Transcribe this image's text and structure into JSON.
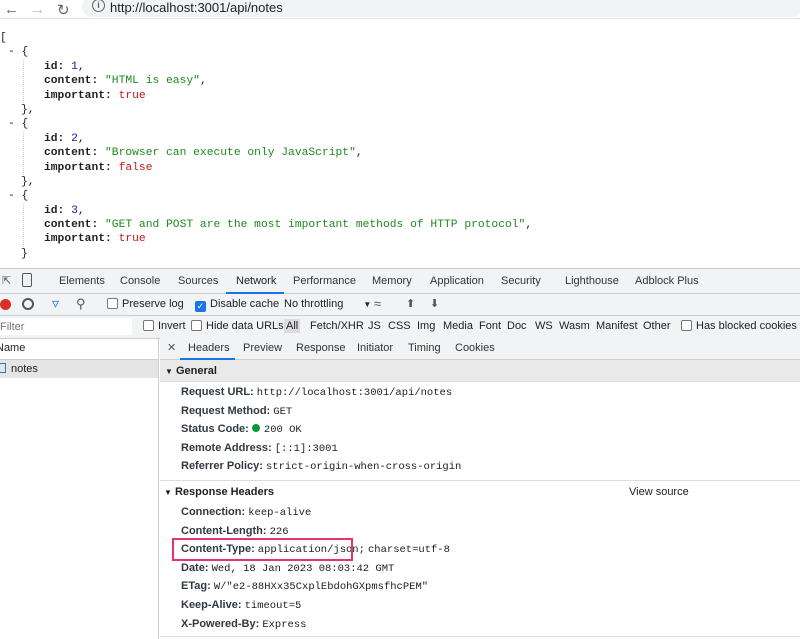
{
  "browser": {
    "url": "http://localhost:3001/api/notes"
  },
  "notes": [
    {
      "id": "1",
      "content": "\"HTML is easy\"",
      "important": "true"
    },
    {
      "id": "2",
      "content": "\"Browser can execute only JavaScript\"",
      "important": "false"
    },
    {
      "id": "3",
      "content": "\"GET and POST are the most important methods of HTTP protocol\"",
      "important": "true"
    }
  ],
  "json_labels": {
    "open_bracket": "[",
    "collapse": "- {",
    "close_obj_comma": "},",
    "close_obj": "}",
    "id_key": "id:",
    "content_key": "content:",
    "important_key": "important:"
  },
  "devtools": {
    "tabs": [
      "Elements",
      "Console",
      "Sources",
      "Network",
      "Performance",
      "Memory",
      "Application",
      "Security",
      "Lighthouse",
      "Adblock Plus"
    ],
    "active_tab": "Network",
    "toolbar": {
      "preserve_log": "Preserve log",
      "disable_cache": "Disable cache",
      "throttling": "No throttling"
    },
    "filter": {
      "placeholder": "Filter",
      "invert": "Invert",
      "hide_data_urls": "Hide data URLs",
      "types": [
        "All",
        "Fetch/XHR",
        "JS",
        "CSS",
        "Img",
        "Media",
        "Font",
        "Doc",
        "WS",
        "Wasm",
        "Manifest",
        "Other"
      ],
      "has_blocked_cookies": "Has blocked cookies"
    },
    "request_list": {
      "header": "Name",
      "items": [
        "notes"
      ]
    },
    "detail_tabs": [
      "Headers",
      "Preview",
      "Response",
      "Initiator",
      "Timing",
      "Cookies"
    ],
    "general": {
      "title": "General",
      "rows": [
        {
          "k": "Request URL:",
          "v": "http://localhost:3001/api/notes"
        },
        {
          "k": "Request Method:",
          "v": "GET"
        },
        {
          "k": "Status Code:",
          "v": "200 OK"
        },
        {
          "k": "Remote Address:",
          "v": "[::1]:3001"
        },
        {
          "k": "Referrer Policy:",
          "v": "strict-origin-when-cross-origin"
        }
      ]
    },
    "response_headers": {
      "title": "Response Headers",
      "view_source": "View source",
      "rows": [
        {
          "k": "Connection:",
          "v": "keep-alive"
        },
        {
          "k": "Content-Length:",
          "v": "226"
        },
        {
          "k": "Content-Type:",
          "v": "application/json;",
          "v2": "charset=utf-8"
        },
        {
          "k": "Date:",
          "v": "Wed, 18 Jan 2023 08:03:42 GMT"
        },
        {
          "k": "ETag:",
          "v": "W/\"e2-88HXx35CxplEbdohGXpmsfhcPEM\""
        },
        {
          "k": "Keep-Alive:",
          "v": "timeout=5"
        },
        {
          "k": "X-Powered-By:",
          "v": "Express"
        }
      ]
    },
    "colors": {
      "highlight_box": "#e8336d",
      "status_ok": "#0a9a3c",
      "accent": "#1a73e8",
      "record": "#d93025"
    }
  }
}
